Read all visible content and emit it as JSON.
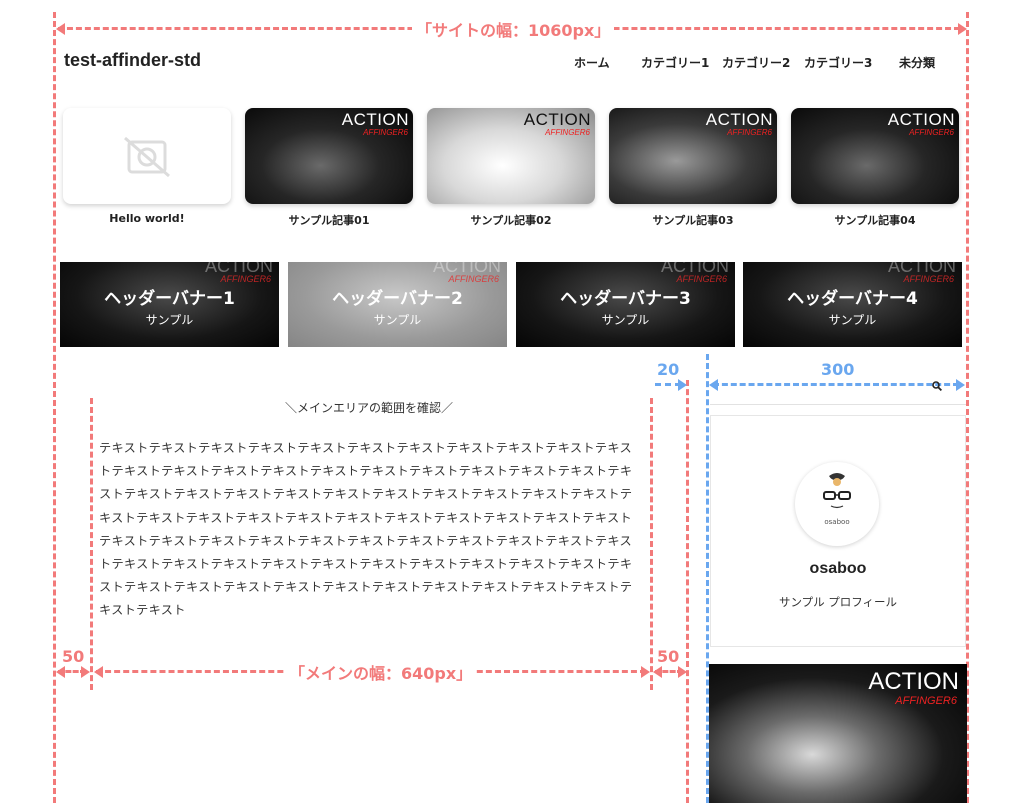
{
  "annotations": {
    "site_width": "「サイトの幅：1060px」",
    "main_width": "「メインの幅：640px」",
    "margin_left": "50",
    "margin_right": "50",
    "gap": "20",
    "sidebar_width": "300"
  },
  "header": {
    "site_title": "test-affinder-std",
    "nav": [
      "ホーム",
      "カテゴリー1",
      "カテゴリー2",
      "カテゴリー3",
      "未分類"
    ]
  },
  "cards": [
    {
      "title": "Hello world!",
      "image": "no-image-icon"
    },
    {
      "title": "サンプル記事01",
      "image": "ACTION"
    },
    {
      "title": "サンプル記事02",
      "image": "ACTION"
    },
    {
      "title": "サンプル記事03",
      "image": "ACTION"
    },
    {
      "title": "サンプル記事04",
      "image": "ACTION"
    }
  ],
  "image_text": {
    "action": "ACTION",
    "affinger": "AFFINGER6"
  },
  "banners": [
    {
      "title": "ヘッダーバナー1",
      "sub": "サンプル"
    },
    {
      "title": "ヘッダーバナー2",
      "sub": "サンプル"
    },
    {
      "title": "ヘッダーバナー3",
      "sub": "サンプル"
    },
    {
      "title": "ヘッダーバナー4",
      "sub": "サンプル"
    }
  ],
  "main": {
    "heading": "＼メインエリアの範囲を確認／",
    "body": "テキストテキストテキストテキストテキストテキストテキストテキストテキストテキストテキストテキストテキストテキストテキストテキストテキストテキストテキストテキストテキストテキストテキストテキストテキストテキストテキストテキストテキストテキストテキストテキストテキストテキストテキストテキストテキストテキストテキストテキストテキストテキストテキストテキストテキストテキストテキストテキストテキストテキストテキストテキストテキストテキストテキストテキストテキストテキストテキストテキストテキストテキストテキストテキストテキストテキストテキストテキストテキストテキストテキストテキストテキストテキストテキストテキストテキスト"
  },
  "sidebar": {
    "search_icon": "search-icon",
    "avatar_label": "osaboo",
    "profile_name": "osaboo",
    "profile_desc": "サンプル プロフィール"
  },
  "colors": {
    "annotation_red": "#f27a7a",
    "annotation_blue": "#6aa7ef",
    "affinger_red": "#e22222"
  }
}
